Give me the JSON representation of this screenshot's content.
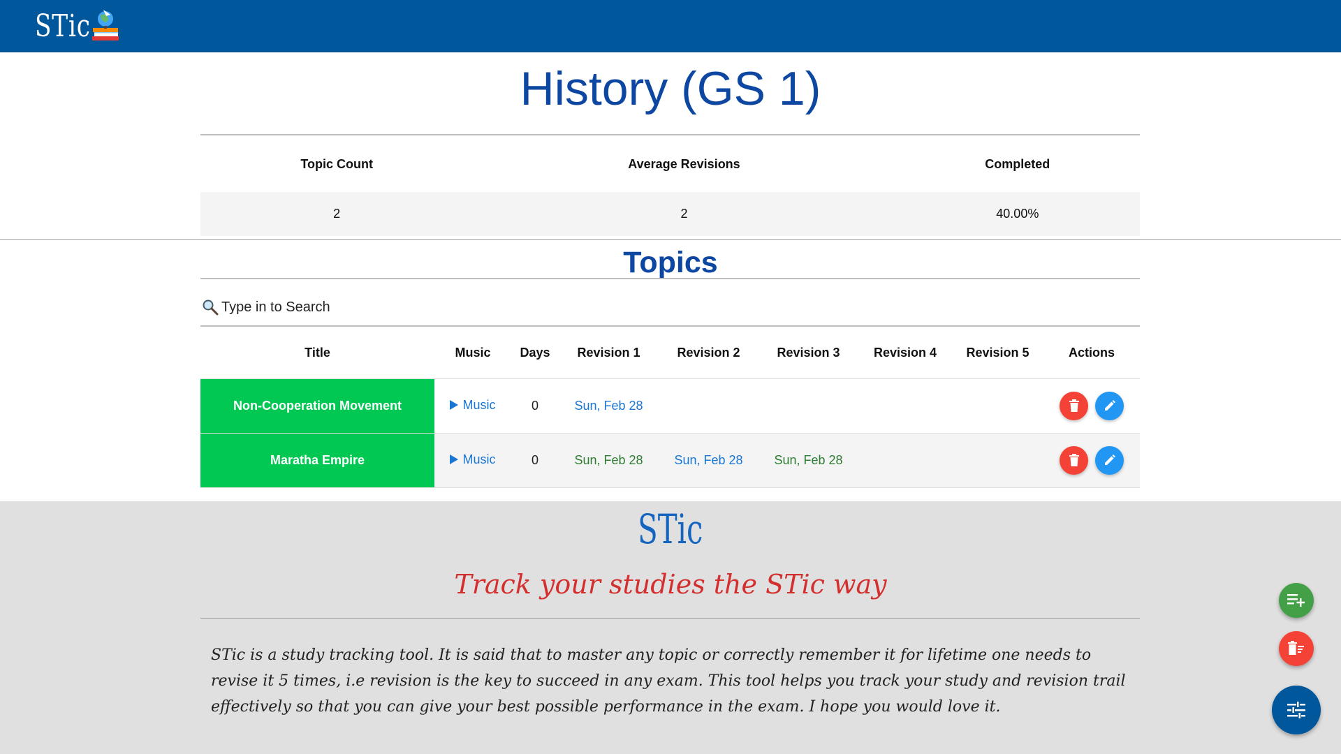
{
  "navbar": {
    "brand": "STic",
    "logo_icon": "study-globe-books-icon",
    "bg_color": "#01579b"
  },
  "page": {
    "title": "History (GS 1)"
  },
  "stats": {
    "headers": [
      "Topic Count",
      "Average Revisions",
      "Completed"
    ],
    "values": [
      "2",
      "2",
      "40.00%"
    ]
  },
  "topics": {
    "heading": "Topics",
    "search_placeholder": "Type in to Search",
    "columns": [
      "Title",
      "Music",
      "Days",
      "Revision 1",
      "Revision 2",
      "Revision 3",
      "Revision 4",
      "Revision 5",
      "Actions"
    ],
    "rows": [
      {
        "title": "Non-Cooperation Movement",
        "music": "Music",
        "days": "0",
        "revisions": [
          "Sun, Feb 28",
          "",
          "",
          "",
          ""
        ]
      },
      {
        "title": "Maratha Empire",
        "music": "Music",
        "days": "0",
        "revisions": [
          "Sun, Feb 28",
          "Sun, Feb 28",
          "Sun, Feb 28",
          "",
          ""
        ]
      }
    ],
    "colors": {
      "title_bg": "#00c853",
      "delete": "#f44336",
      "edit": "#2196f3",
      "link": "#1976d2",
      "done": "#2e7d32"
    }
  },
  "footer": {
    "brand": "STic",
    "tagline": "Track your studies the STic way",
    "about": "STic is a study tracking tool. It is said that to master any topic or correctly remember it for lifetime one needs to revise it 5 times, i.e revision is the key to succeed in any exam. This tool helps you track your study and revision trail effectively so that you can give your best possible performance in the exam. I hope you would love it."
  },
  "fabs": {
    "add_icon": "playlist-add-icon",
    "delete_icon": "delete-sweep-icon",
    "menu_icon": "tune-icon"
  }
}
